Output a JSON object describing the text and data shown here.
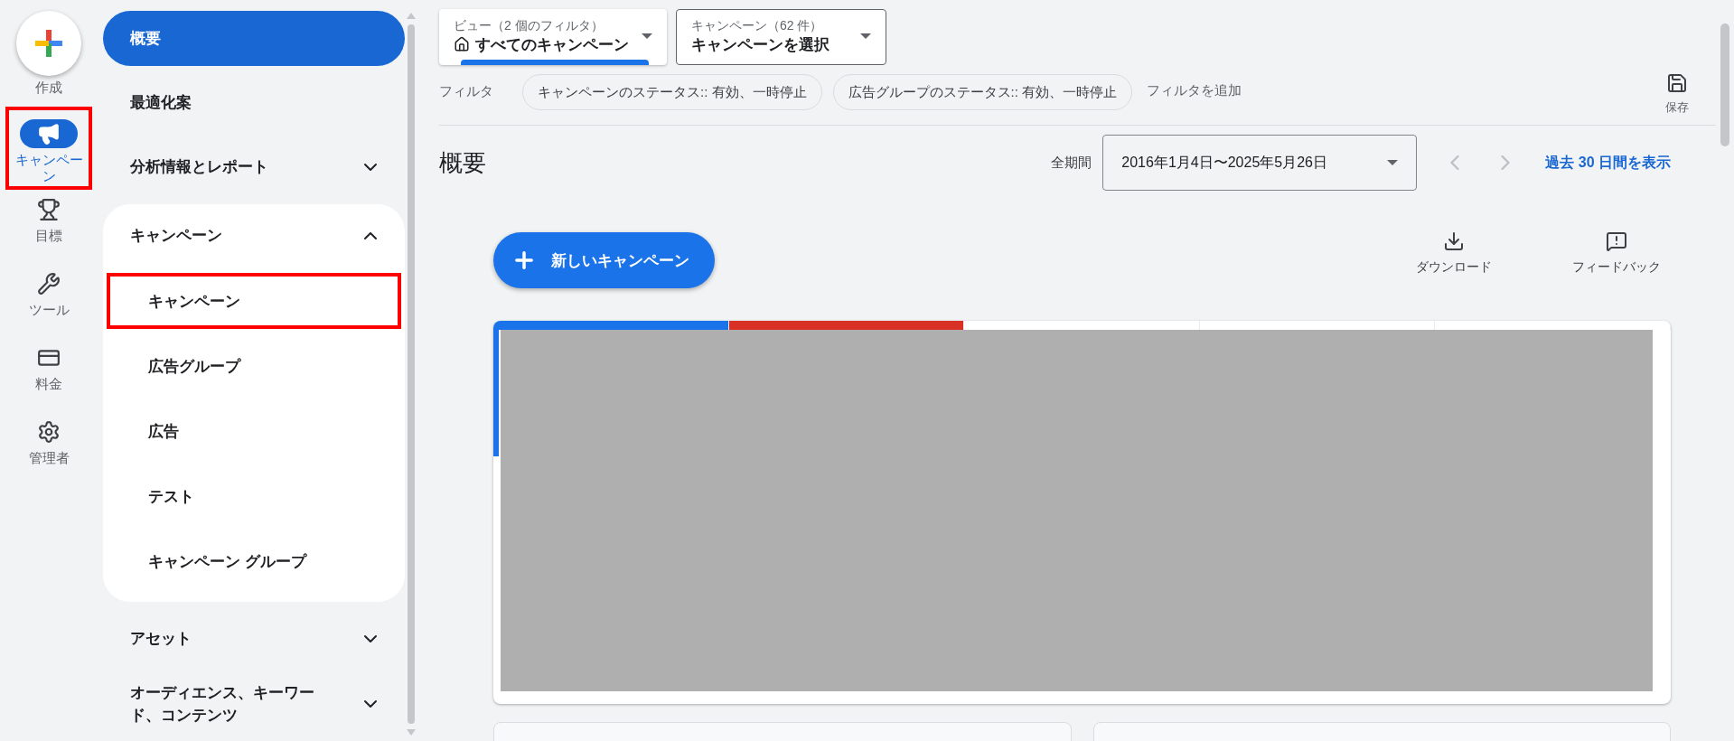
{
  "rail": {
    "create": {
      "label": "作成"
    },
    "items": [
      {
        "label": "キャンペーン",
        "selected": true,
        "highlighted": true
      },
      {
        "label": "目標",
        "selected": false,
        "highlighted": false
      },
      {
        "label": "ツール",
        "selected": false,
        "highlighted": false
      },
      {
        "label": "料金",
        "selected": false,
        "highlighted": false
      },
      {
        "label": "管理者",
        "selected": false,
        "highlighted": false
      }
    ]
  },
  "nav": [
    {
      "kind": "link",
      "label": "概要",
      "selected": true
    },
    {
      "kind": "link",
      "label": "最適化案",
      "selected": false
    },
    {
      "kind": "group",
      "label": "分析情報とレポート",
      "expanded": false
    },
    {
      "kind": "group",
      "label": "キャンペーン",
      "expanded": true,
      "children": [
        {
          "label": "キャンペーン",
          "selected": false,
          "highlighted": true
        },
        {
          "label": "広告グループ",
          "selected": false,
          "highlighted": false
        },
        {
          "label": "広告",
          "selected": false,
          "highlighted": false
        },
        {
          "label": "テスト",
          "selected": false,
          "highlighted": false
        },
        {
          "label": "キャンペーン グループ",
          "selected": false,
          "highlighted": false
        }
      ]
    },
    {
      "kind": "group",
      "label": "アセット",
      "expanded": false
    },
    {
      "kind": "group",
      "label": "オーディエンス、キーワード、コンテンツ",
      "expanded": false
    }
  ],
  "view_picker": {
    "caption": "ビュー（2 個のフィルタ）",
    "value": "すべてのキャンペーン"
  },
  "campaign_picker": {
    "caption": "キャンペーン（62 件）",
    "value": "キャンペーンを選択"
  },
  "filters": {
    "label": "フィルタ",
    "chips": [
      "キャンペーンのステータス:: 有効、一時停止",
      "広告グループのステータス:: 有効、一時停止"
    ],
    "add": "フィルタを追加"
  },
  "save": {
    "label": "保存"
  },
  "heading": "概要",
  "date": {
    "label": "全期間",
    "range": "2016年1月4日〜2025年5月26日",
    "link": "過去 30 日間を表示"
  },
  "new_campaign": {
    "label": "新しいキャンペーン"
  },
  "actions": [
    {
      "label": "ダウンロード"
    },
    {
      "label": "フィードバック"
    }
  ],
  "metric_tabs": [
    {
      "selected": true,
      "color": "#1a73e8"
    },
    {
      "selected": true,
      "color": "#d93025"
    },
    {
      "selected": false
    },
    {
      "selected": false
    },
    {
      "selected": false
    }
  ]
}
